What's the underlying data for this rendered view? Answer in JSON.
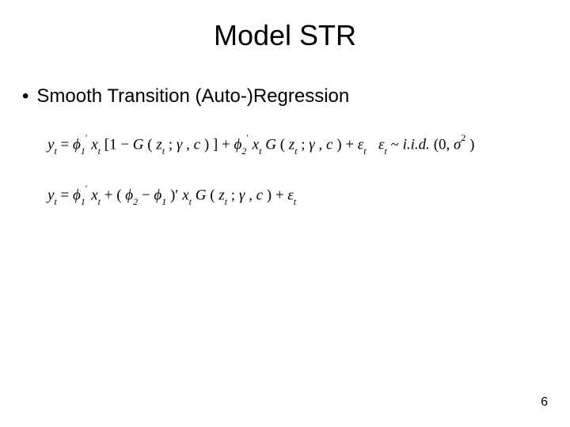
{
  "title": "Model STR",
  "bullet": {
    "marker": "•",
    "text": "Smooth Transition (Auto-)Regression"
  },
  "equations": {
    "eq1": {
      "lhs_var": "y",
      "lhs_sub": "t",
      "eq": " = ",
      "phi": "ϕ",
      "prime": "′",
      "sub1": "1",
      "x": "x",
      "xt": "t",
      "lbrack": "[1 − ",
      "G": "G",
      "lparen": "(",
      "z": "z",
      "zt": "t",
      "semi": "; ",
      "gamma": "γ",
      "comma": ", ",
      "c": "c",
      "rparen": ")",
      "rbrack": "] + ",
      "sub2": "2",
      "plus_eps": " + ",
      "eps": "ε",
      "eps_t": "t"
    },
    "eq_dist": {
      "eps": "ε",
      "eps_t": "t",
      "tilde": " ~ ",
      "iid": "i.i.d.",
      "args": "(0, ",
      "sigma": "σ",
      "sq": "2",
      "close": ")"
    },
    "eq3": {
      "lhs_var": "y",
      "lhs_sub": "t",
      "eq": " = ",
      "phi": "ϕ",
      "prime": "′",
      "sub1": "1",
      "x": "x",
      "xt": "t",
      "plus": " + (",
      "sub2": "2",
      "minus": " − ",
      "rparen_prime": ")′",
      "G": "G",
      "g_l": "(",
      "z": "z",
      "zt": "t",
      "semi": "; ",
      "gamma": "γ",
      "comma": ", ",
      "c": "c",
      "g_r": ")",
      "plus_eps": " + ",
      "eps": "ε",
      "eps_t": "t"
    }
  },
  "page_number": "6"
}
